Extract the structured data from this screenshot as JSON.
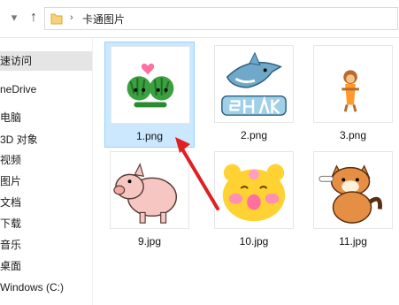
{
  "window": {
    "breadcrumb": "卡通图片"
  },
  "sidebar": {
    "items": [
      {
        "label": "速访问",
        "selected": true
      },
      {
        "label": "neDrive",
        "selected": false
      },
      {
        "label": "电脑",
        "selected": false
      },
      {
        "label": "3D 对象",
        "selected": false
      },
      {
        "label": "视频",
        "selected": false
      },
      {
        "label": "图片",
        "selected": false
      },
      {
        "label": "文档",
        "selected": false
      },
      {
        "label": "下载",
        "selected": false
      },
      {
        "label": "音乐",
        "selected": false
      },
      {
        "label": "桌面",
        "selected": false
      },
      {
        "label": "Windows (C:)",
        "selected": false
      }
    ]
  },
  "files": [
    {
      "name": "1.png",
      "selected": true
    },
    {
      "name": "2.png",
      "selected": false
    },
    {
      "name": "3.png",
      "selected": false
    },
    {
      "name": "9.jpg",
      "selected": false
    },
    {
      "name": "10.jpg",
      "selected": false
    },
    {
      "name": "11.jpg",
      "selected": false
    }
  ],
  "annotation": {
    "color": "#e02020"
  }
}
